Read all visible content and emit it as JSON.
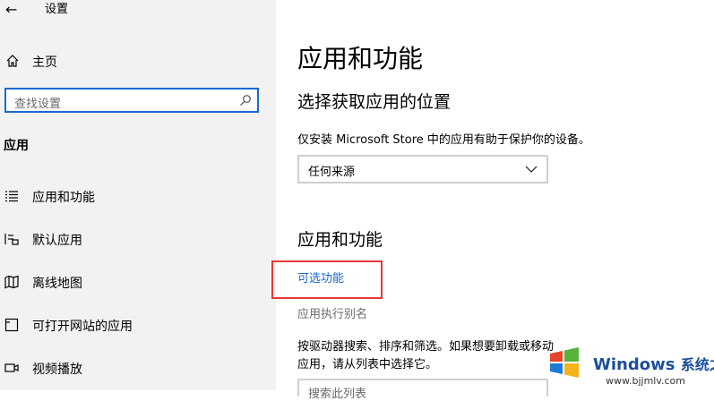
{
  "window": {
    "title": "设置"
  },
  "sidebar": {
    "home_label": "主页",
    "search_placeholder": "查找设置",
    "section_label": "应用",
    "items": [
      {
        "label": "应用和功能",
        "icon": "list-icon"
      },
      {
        "label": "默认应用",
        "icon": "default-apps-icon"
      },
      {
        "label": "离线地图",
        "icon": "map-icon"
      },
      {
        "label": "可打开网站的应用",
        "icon": "open-web-icon"
      },
      {
        "label": "视频播放",
        "icon": "video-icon"
      }
    ]
  },
  "main": {
    "title": "应用和功能",
    "location_title": "选择获取应用的位置",
    "location_desc": "仅安装 Microsoft Store 中的应用有助于保护你的设备。",
    "location_value": "任何来源",
    "apps_title": "应用和功能",
    "optional_features_link": "可选功能",
    "app_alias_link": "应用执行别名",
    "info_text": "按驱动器搜索、排序和筛选。如果想要卸载或移动应用，请从列表中选择它。",
    "list_search_placeholder": "搜索此列表"
  },
  "watermark": {
    "brand": "Windows",
    "brand_cn": "系统之家",
    "url": "www.bjjmlv.com"
  },
  "colors": {
    "accent": "#1a6ad1",
    "highlight": "#e53935",
    "sidebar_bg": "#f2f2f2"
  }
}
